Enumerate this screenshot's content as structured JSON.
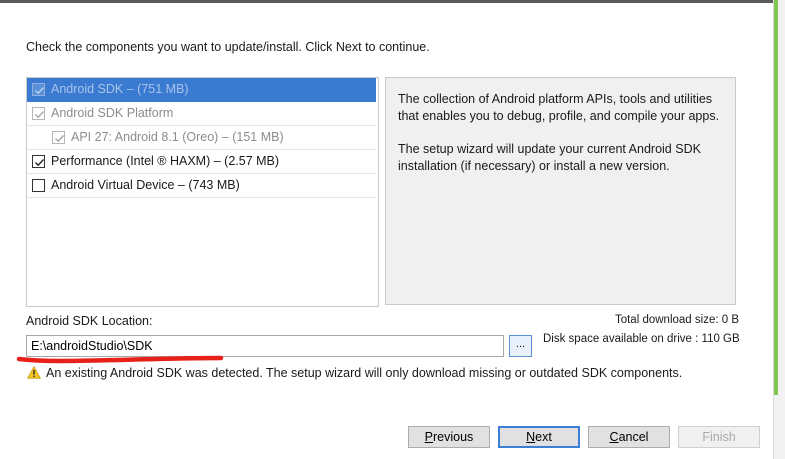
{
  "instruction": "Check the components you want to update/install. Click Next to continue.",
  "components": [
    {
      "label": "Android SDK – (751 MB)",
      "checked": true,
      "disabled": true,
      "selected": true,
      "indent": 0
    },
    {
      "label": "Android SDK Platform",
      "checked": true,
      "disabled": true,
      "selected": false,
      "indent": 0
    },
    {
      "label": "API 27: Android 8.1 (Oreo) – (151 MB)",
      "checked": true,
      "disabled": true,
      "selected": false,
      "indent": 1
    },
    {
      "label": "Performance (Intel ® HAXM) – (2.57 MB)",
      "checked": true,
      "disabled": false,
      "selected": false,
      "indent": 0
    },
    {
      "label": "Android Virtual Device – (743 MB)",
      "checked": false,
      "disabled": false,
      "selected": false,
      "indent": 0
    }
  ],
  "description": {
    "para1": "The collection of Android platform APIs, tools and utilities that enables you to debug, profile, and compile your apps.",
    "para2": "The setup wizard will update your current Android SDK installation (if necessary) or install a new version."
  },
  "sdk_location": {
    "label": "Android SDK Location:",
    "value": "E:\\androidStudio\\SDK",
    "browse_label": "..."
  },
  "total_download": "Total download size: 0 B",
  "disk_space": "Disk space available on drive : 110 GB",
  "warning": {
    "icon": "warning-icon",
    "text": "An existing Android SDK was detected. The setup wizard will only download missing or outdated SDK components."
  },
  "buttons": {
    "previous": {
      "mn": "P",
      "rest": "revious"
    },
    "next": {
      "mn": "N",
      "rest": "ext"
    },
    "cancel": {
      "mn": "C",
      "rest": "ancel"
    },
    "finish": "Finish"
  },
  "colors": {
    "selection": "#3a7bd1",
    "annotation_stroke": "#e8201a",
    "window_accent": "#7ec850"
  }
}
